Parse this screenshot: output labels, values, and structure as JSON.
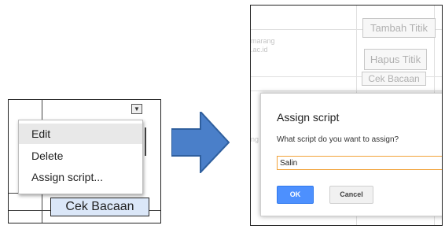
{
  "left": {
    "menu": {
      "items": [
        "Edit",
        "Delete",
        "Assign script..."
      ]
    },
    "cek_button_label": "Cek Bacaan"
  },
  "right": {
    "background": {
      "faded_text_1": "marang",
      "faded_text_2": ".ac.id",
      "faded_text_3": "ng"
    },
    "buttons": {
      "tambah": "Tambah Titik",
      "hapus": "Hapus Titik",
      "cek": "Cek Bacaan"
    },
    "dialog": {
      "title": "Assign script",
      "prompt": "What script do you want to assign?",
      "input_value": "Salin",
      "ok_label": "OK",
      "cancel_label": "Cancel"
    }
  },
  "colors": {
    "arrow_fill": "#4a7fc9",
    "cek_button_bg": "#dbe7f8",
    "ok_button_bg": "#4d90fe",
    "input_border": "#f2a33a",
    "menu_highlight": "#e8e8e8"
  },
  "icons": {
    "dropdown": "chevron-down-icon",
    "arrow": "arrow-right-icon"
  }
}
